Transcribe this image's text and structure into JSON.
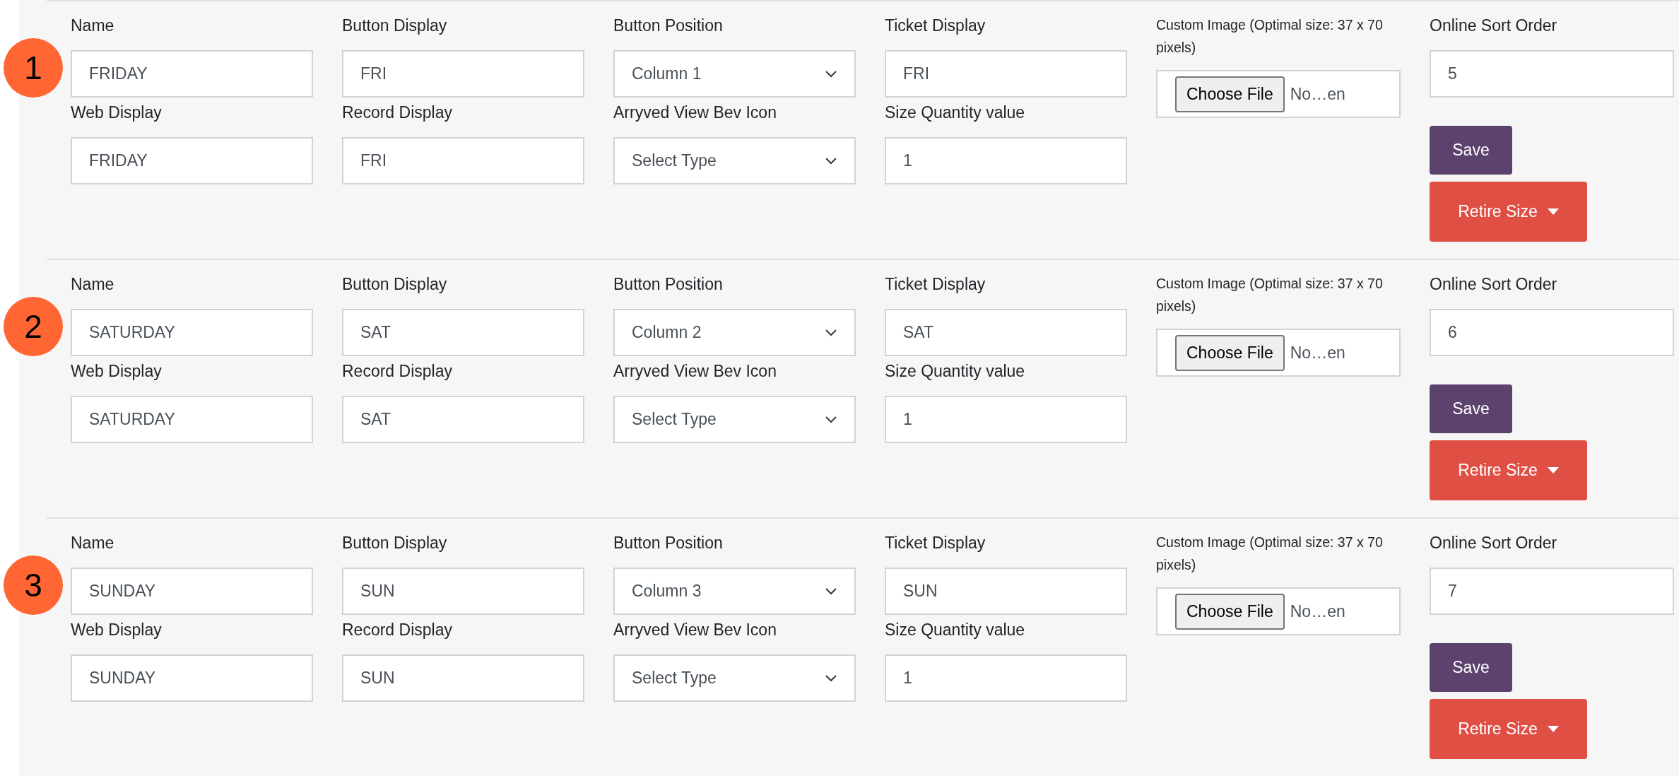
{
  "sections": [
    {
      "badge": "1",
      "fields": [
        {
          "label": "Name",
          "value": "FRIDAY",
          "kind": "text"
        },
        {
          "label": "Button Display",
          "value": "FRI",
          "kind": "text"
        },
        {
          "label": "Button Position",
          "value": "Column 1",
          "kind": "select"
        },
        {
          "label": "Ticket Display",
          "value": "FRI",
          "kind": "text"
        },
        {
          "label": "Web Display",
          "value": "FRIDAY",
          "kind": "text"
        },
        {
          "label": "Record Display",
          "value": "FRI",
          "kind": "text"
        },
        {
          "label": "Arryved View Bev Icon",
          "value": "Select Type",
          "kind": "select"
        },
        {
          "label": "Size Quantity value",
          "value": "1",
          "kind": "text"
        }
      ],
      "image": {
        "label": "Custom Image (Optimal size: 37 x 70 pixels)",
        "button": "Choose File",
        "file_name": "No…en"
      },
      "sort": {
        "label": "Online Sort Order",
        "value": "5"
      },
      "save": "Save",
      "retire": "Retire Size"
    },
    {
      "badge": "2",
      "fields": [
        {
          "label": "Name",
          "value": "SATURDAY",
          "kind": "text"
        },
        {
          "label": "Button Display",
          "value": "SAT",
          "kind": "text"
        },
        {
          "label": "Button Position",
          "value": "Column 2",
          "kind": "select"
        },
        {
          "label": "Ticket Display",
          "value": "SAT",
          "kind": "text"
        },
        {
          "label": "Web Display",
          "value": "SATURDAY",
          "kind": "text"
        },
        {
          "label": "Record Display",
          "value": "SAT",
          "kind": "text"
        },
        {
          "label": "Arryved View Bev Icon",
          "value": "Select Type",
          "kind": "select"
        },
        {
          "label": "Size Quantity value",
          "value": "1",
          "kind": "text"
        }
      ],
      "image": {
        "label": "Custom Image (Optimal size: 37 x 70 pixels)",
        "button": "Choose File",
        "file_name": "No…en"
      },
      "sort": {
        "label": "Online Sort Order",
        "value": "6"
      },
      "save": "Save",
      "retire": "Retire Size"
    },
    {
      "badge": "3",
      "fields": [
        {
          "label": "Name",
          "value": "SUNDAY",
          "kind": "text"
        },
        {
          "label": "Button Display",
          "value": "SUN",
          "kind": "text"
        },
        {
          "label": "Button Position",
          "value": "Column 3",
          "kind": "select"
        },
        {
          "label": "Ticket Display",
          "value": "SUN",
          "kind": "text"
        },
        {
          "label": "Web Display",
          "value": "SUNDAY",
          "kind": "text"
        },
        {
          "label": "Record Display",
          "value": "SUN",
          "kind": "text"
        },
        {
          "label": "Arryved View Bev Icon",
          "value": "Select Type",
          "kind": "select"
        },
        {
          "label": "Size Quantity value",
          "value": "1",
          "kind": "text"
        }
      ],
      "image": {
        "label": "Custom Image (Optimal size: 37 x 70 pixels)",
        "button": "Choose File",
        "file_name": "No…en"
      },
      "sort": {
        "label": "Online Sort Order",
        "value": "7"
      },
      "save": "Save",
      "retire": "Retire Size"
    }
  ]
}
